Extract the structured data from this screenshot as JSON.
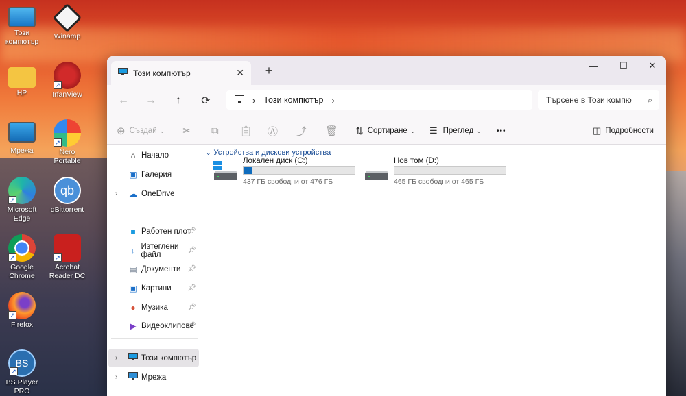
{
  "desktop": {
    "icons": [
      {
        "label": "Този компютър",
        "name": "this-pc"
      },
      {
        "label": "Winamp",
        "name": "winamp"
      },
      {
        "label": "HP",
        "name": "hp"
      },
      {
        "label": "IrfanView",
        "name": "irfanview"
      },
      {
        "label": "Мрежа",
        "name": "network"
      },
      {
        "label": "Nero Portable",
        "name": "nero-portable"
      },
      {
        "label": "Microsoft Edge",
        "name": "microsoft-edge"
      },
      {
        "label": "qBittorrent",
        "name": "qbittorrent"
      },
      {
        "label": "Google Chrome",
        "name": "google-chrome"
      },
      {
        "label": "Acrobat Reader DC",
        "name": "acrobat-reader-dc"
      },
      {
        "label": "Firefox",
        "name": "firefox"
      },
      {
        "label": "BS.Player PRO",
        "name": "bsplayer-pro"
      }
    ]
  },
  "window": {
    "tab_title": "Този компютър",
    "new_tab": "+",
    "controls": {
      "minimize": "—",
      "maximize": "☐",
      "close": "✕"
    },
    "address": {
      "location": "Този компютър"
    },
    "search": {
      "placeholder": "Търсене в Този компю"
    },
    "toolbar": {
      "new_label": "Създай",
      "sort_label": "Сортиране",
      "view_label": "Преглед",
      "more_label": "•••",
      "details_label": "Подробности"
    }
  },
  "sidebar": {
    "top": [
      {
        "label": "Начало"
      },
      {
        "label": "Галерия"
      },
      {
        "label": "OneDrive"
      }
    ],
    "pinned": [
      {
        "label": "Работен плот"
      },
      {
        "label": "Изтеглени файл"
      },
      {
        "label": "Документи"
      },
      {
        "label": "Картини"
      },
      {
        "label": "Музика"
      },
      {
        "label": "Видеоклипове"
      }
    ],
    "bottom": [
      {
        "label": "Този компютър"
      },
      {
        "label": "Мрежа"
      }
    ]
  },
  "content": {
    "group_header": "Устройства и дискови устройства",
    "drives": [
      {
        "name": "Локален диск (C:)",
        "free": "437 ГБ свободни от 476 ГБ",
        "used_fraction": 0.082
      },
      {
        "name": "Нов том (D:)",
        "free": "465 ГБ свободни от 465 ГБ",
        "used_fraction": 0.0
      }
    ]
  },
  "colors": {
    "accent": "#0f6cbd",
    "group_header": "#174a93"
  }
}
